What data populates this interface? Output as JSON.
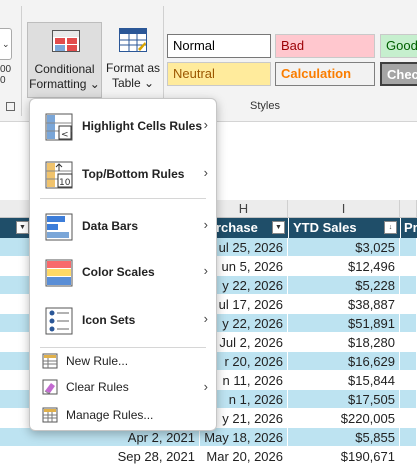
{
  "ribbon": {
    "conditional_formatting": {
      "line1": "Conditional",
      "line2": "Formatting ⌄"
    },
    "format_as_table": {
      "line1": "Format as",
      "line2": "Table ⌄"
    },
    "left_fragment_top": "00",
    "left_fragment_bottom": "0",
    "styles": [
      {
        "label": "Normal",
        "bg": "#ffffff",
        "fg": "#000000"
      },
      {
        "label": "Bad",
        "bg": "#ffc7ce",
        "fg": "#9c0006"
      },
      {
        "label": "Good",
        "bg": "#c6efce",
        "fg": "#006100"
      },
      {
        "label": "Neutral",
        "bg": "#ffeb9c",
        "fg": "#9c5700"
      },
      {
        "label": "Calculation",
        "bg": "#f2f2f2",
        "fg": "#fa7d00"
      },
      {
        "label": "Check",
        "bg": "#a5a5a5",
        "fg": "#ffffff"
      }
    ],
    "styles_group_label": "Styles"
  },
  "sheet": {
    "column_headers": [
      "H",
      "I"
    ],
    "table_headers": {
      "h": "urchase",
      "i": "YTD Sales",
      "j": "Pr"
    },
    "rows": [
      {
        "a": "",
        "h": "ul 25, 2026",
        "i": "$3,025"
      },
      {
        "a": "",
        "h": "un 5, 2026",
        "i": "$12,496"
      },
      {
        "a": "",
        "h": "y 22, 2026",
        "i": "$5,228"
      },
      {
        "a": "",
        "h": "ul 17, 2026",
        "i": "$38,887"
      },
      {
        "a": "",
        "h": "y 22, 2026",
        "i": "$51,891"
      },
      {
        "a": "",
        "h": "Jul 2, 2026",
        "i": "$18,280"
      },
      {
        "a": "",
        "h": "r 20, 2026",
        "i": "$16,629"
      },
      {
        "a": "",
        "h": "n 11, 2026",
        "i": "$15,844"
      },
      {
        "a": "",
        "h": "n 1, 2026",
        "i": "$17,505"
      },
      {
        "a": "",
        "h": "y 21, 2026",
        "i": "$220,005"
      },
      {
        "a": "Apr 2, 2021",
        "h": "May 18, 2026",
        "i": "$5,855"
      },
      {
        "a": "Sep 28, 2021",
        "h": "Mar 20, 2026",
        "i": "$190,671"
      }
    ],
    "colors": {
      "band": "#bde3f1",
      "plain": "#ffffff",
      "header": "#1f4e69"
    }
  },
  "menu": {
    "items": [
      {
        "label": "Highlight Cells Rules",
        "icon": "highlight-cells-icon",
        "submenu": true
      },
      {
        "label": "Top/Bottom Rules",
        "icon": "top-bottom-icon",
        "submenu": true
      },
      {
        "label": "Data Bars",
        "icon": "data-bars-icon",
        "submenu": true
      },
      {
        "label": "Color Scales",
        "icon": "color-scales-icon",
        "submenu": true
      },
      {
        "label": "Icon Sets",
        "icon": "icon-sets-icon",
        "submenu": true
      }
    ],
    "actions": [
      {
        "label": "New Rule...",
        "icon": "new-rule-icon",
        "submenu": false
      },
      {
        "label": "Clear Rules",
        "icon": "clear-rules-icon",
        "submenu": true
      },
      {
        "label": "Manage Rules...",
        "icon": "manage-rules-icon",
        "submenu": false
      }
    ],
    "arrow": "›",
    "topbottom_icon_text": "10"
  }
}
